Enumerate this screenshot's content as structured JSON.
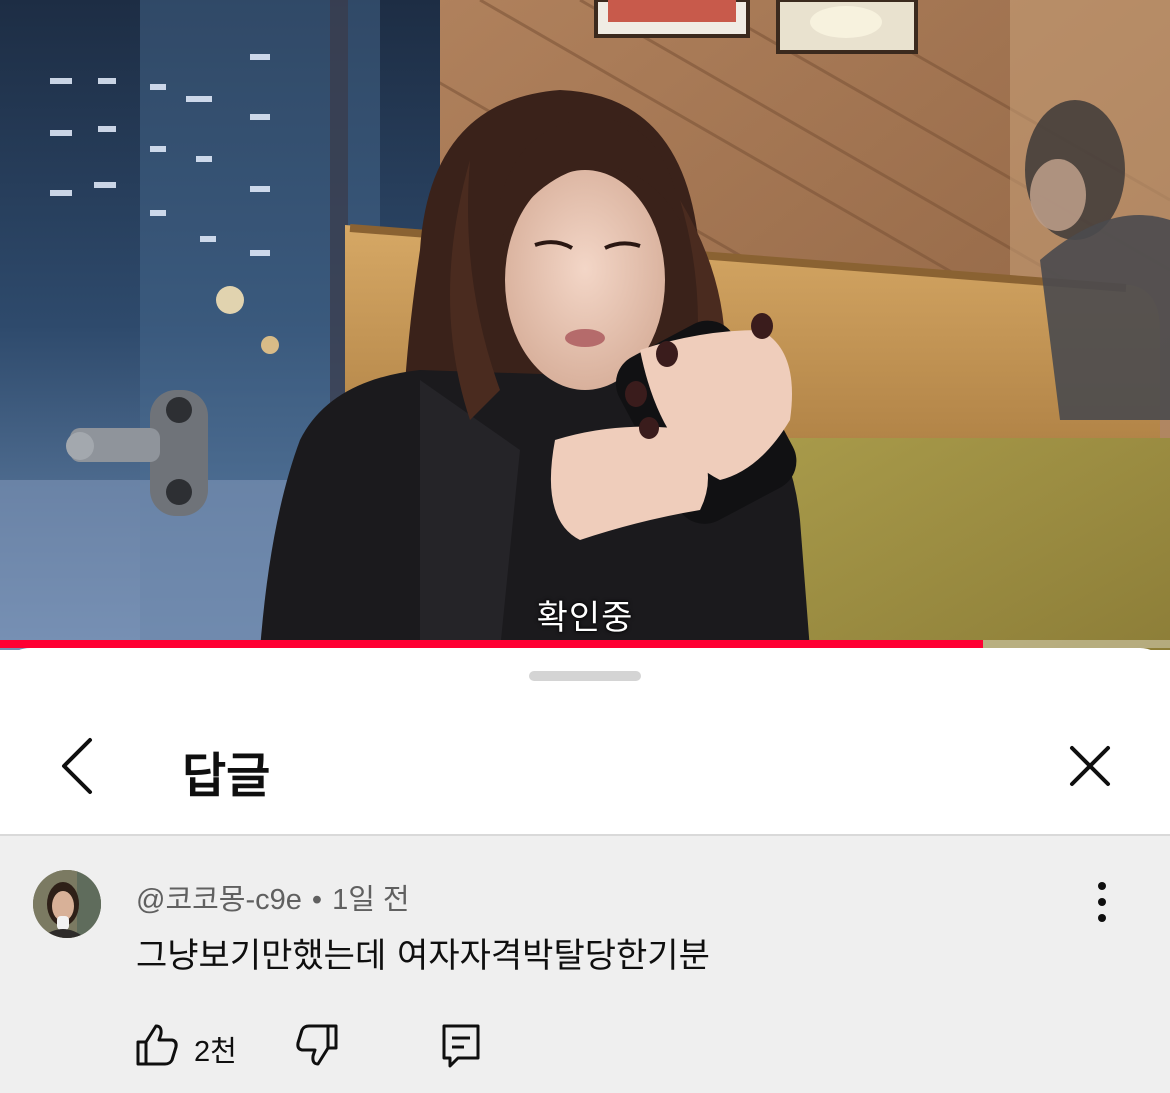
{
  "video": {
    "subtitle": "확인중",
    "progress": 0.84,
    "progress_color": "#ff0033"
  },
  "sheet": {
    "title": "답글",
    "back_icon": "chevron-left-icon",
    "close_icon": "close-icon"
  },
  "comment": {
    "author": "@코코몽-c9e",
    "separator": "•",
    "time": "1일 전",
    "text": "그냥보기만했는데 여자자격박탈당한기분",
    "likes": "2천",
    "like_icon": "thumb-up-icon",
    "dislike_icon": "thumb-down-icon",
    "reply_icon": "reply-icon",
    "more_icon": "more-vertical-icon"
  },
  "colors": {
    "accent": "#ff0033",
    "sheet_bg": "#ffffff",
    "comment_bg": "#efefef",
    "meta_text": "#606060"
  }
}
